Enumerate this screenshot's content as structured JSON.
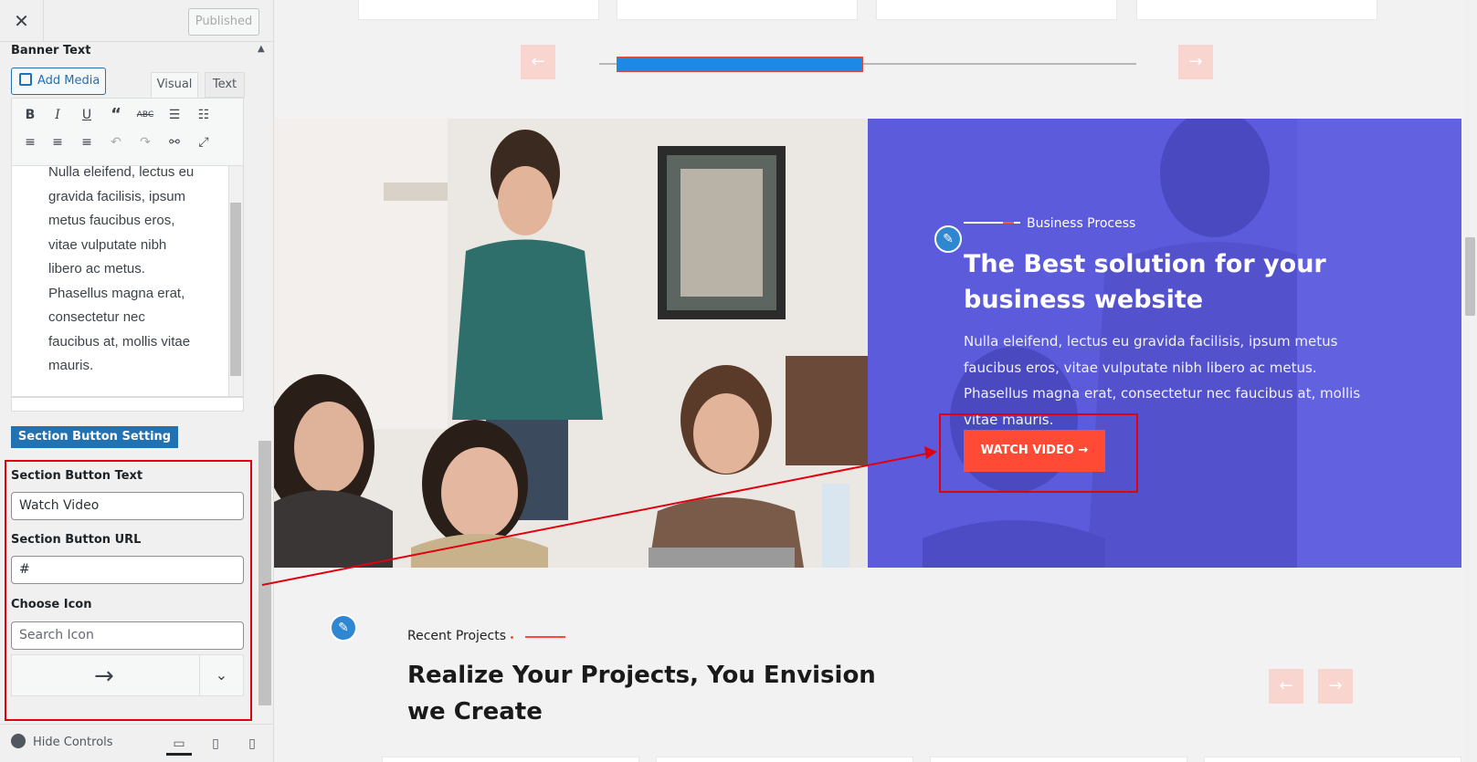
{
  "topbar": {
    "close_label": "✕",
    "publish_label": "Published"
  },
  "section": {
    "title": "Banner Text"
  },
  "editor": {
    "add_media_label": "Add Media",
    "tab_visual": "Visual",
    "tab_text": "Text",
    "content": "Nulla eleifend, lectus eu gravida facilisis, ipsum metus faucibus eros, vitae vulputate nibh libero ac metus. Phasellus magna erat, consectetur nec faucibus at, mollis vitae mauris."
  },
  "button_setting": {
    "heading": "Section Button Setting",
    "text_label": "Section Button Text",
    "text_value": "Watch Video",
    "url_label": "Section Button URL",
    "url_value": "#",
    "icon_label": "Choose Icon",
    "icon_placeholder": "Search Icon",
    "icon_preview": "→"
  },
  "footer": {
    "hide_controls": "Hide Controls"
  },
  "hero": {
    "kicker": "Business Process",
    "title": "The Best solution for your business website",
    "description": "Nulla eleifend, lectus eu gravida facilisis, ipsum metus faucibus eros, vitae vulputate nibh libero ac metus. Phasellus magna erat, consectetur nec faucibus at, mollis vitae mauris.",
    "button_label": "WATCH VIDEO →"
  },
  "projects": {
    "kicker": "Recent Projects",
    "title": "Realize Your Projects, You Envision we Create"
  },
  "colors": {
    "accent_blue": "#2271b1",
    "hero_purple": "#5c5bdc",
    "cta_red": "#ff4a35",
    "highlight_red": "#e0000f"
  }
}
